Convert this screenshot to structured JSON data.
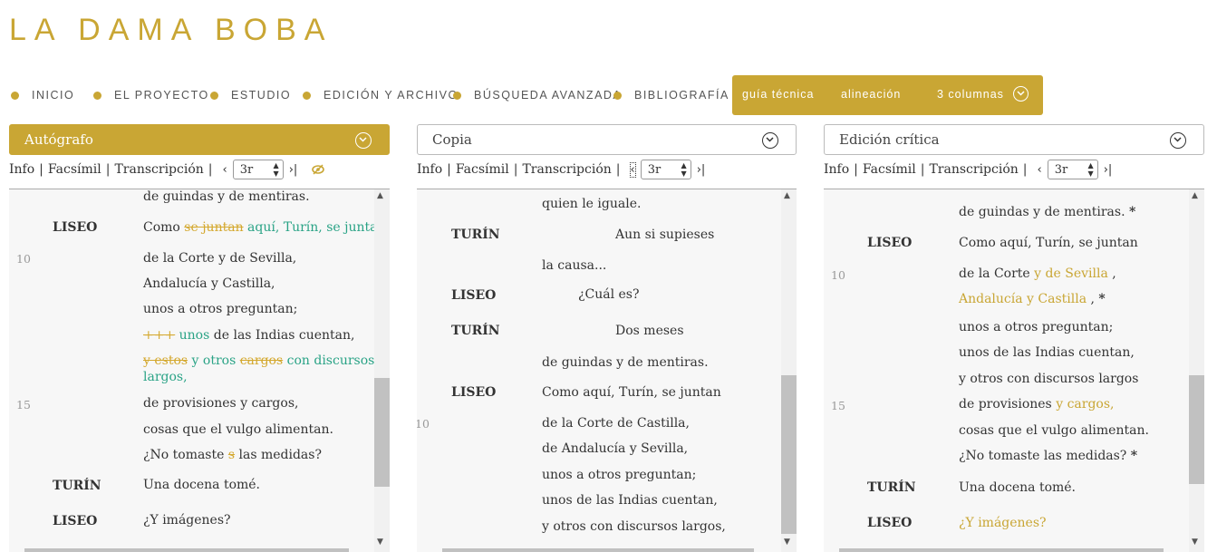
{
  "site_title": "LA DAMA BOBA",
  "nav": [
    "INICIO",
    "EL PROYECTO",
    "ESTUDIO",
    "EDICIÓN Y ARCHIVO",
    "BÚSQUEDA AVANZADA",
    "BIBLIOGRAFÍA"
  ],
  "tools": {
    "guide": "guía técnica",
    "align": "alineación",
    "columns": "3 columnas"
  },
  "colors": {
    "accent": "#c9a634",
    "added": "#2aa386",
    "deleted": "#d4a82e"
  },
  "toolbar": {
    "info": "Info",
    "facsimile": "Facsímil",
    "transcription": "Transcripción",
    "page": "3r",
    "sep": "|"
  },
  "panels": [
    {
      "title": "Autógrafo",
      "lines": {
        "l1": "de guindas y de mentiras.",
        "sp1": "LISEO",
        "l2a": "Como ",
        "l2b": "se juntan",
        "l2c": " aquí, Turín, se juntan",
        "n10": "10",
        "l3": "de la Corte y de Sevilla,",
        "l4": "Andalucía y Castilla,",
        "l5": "unos a otros preguntan;",
        "l6a": "+++",
        "l6b": " unos",
        "l6c": " de las Indias cuentan,",
        "l7a": "y estos",
        "l7b": " y otros ",
        "l7c": "cargos",
        "l7d": " con discursos",
        "l7e": "largos,",
        "n15": "15",
        "l8": "de provisiones y cargos,",
        "l9": "cosas que el vulgo alimentan.",
        "l10a": "¿No tomaste ",
        "l10b": "s",
        "l10c": " las medidas?",
        "sp2": "TURÍN",
        "l11": "Una docena tomé.",
        "sp3": "LISEO",
        "l12": "¿Y imágenes?"
      }
    },
    {
      "title": "Copia",
      "lines": {
        "l1": "quien le iguale.",
        "sp1": "TURÍN",
        "l2": "Aun si supieses",
        "l3": "la causa...",
        "sp2": "LISEO",
        "l4": "¿Cuál es?",
        "sp3": "TURÍN",
        "l5": "Dos meses",
        "l6": "de guindas y de mentiras.",
        "sp4": "LISEO",
        "l7": "Como aquí, Turín, se juntan",
        "n10": "10",
        "l8": "de la Corte de Castilla,",
        "l9": "de Andalucía y Sevilla,",
        "l10": "unos a otros preguntan;",
        "l11": "unos de las Indias cuentan,",
        "l12": "y otros con discursos largos,"
      }
    },
    {
      "title": "Edición crítica",
      "lines": {
        "l1": "de guindas y de mentiras.",
        "ast": "*",
        "sp1": "LISEO",
        "l2": "Como aquí, Turín, se juntan",
        "n10": "10",
        "l3a": "de la Corte ",
        "l3b": "y de Sevilla",
        "l3c": " ,",
        "l4a": "Andalucía y Castilla",
        "l4b": " ,",
        "l5": "unos a otros preguntan;",
        "l6": "unos de las Indias cuentan,",
        "l7": "y otros con discursos largos",
        "n15": "15",
        "l8a": "de provisiones ",
        "l8b": "y cargos,",
        "l9": "cosas que el vulgo alimentan.",
        "l10": "¿No tomaste las medidas?",
        "sp2": "TURÍN",
        "l11": "Una docena tomé.",
        "sp3": "LISEO",
        "l12": "¿Y imágenes?"
      }
    }
  ]
}
